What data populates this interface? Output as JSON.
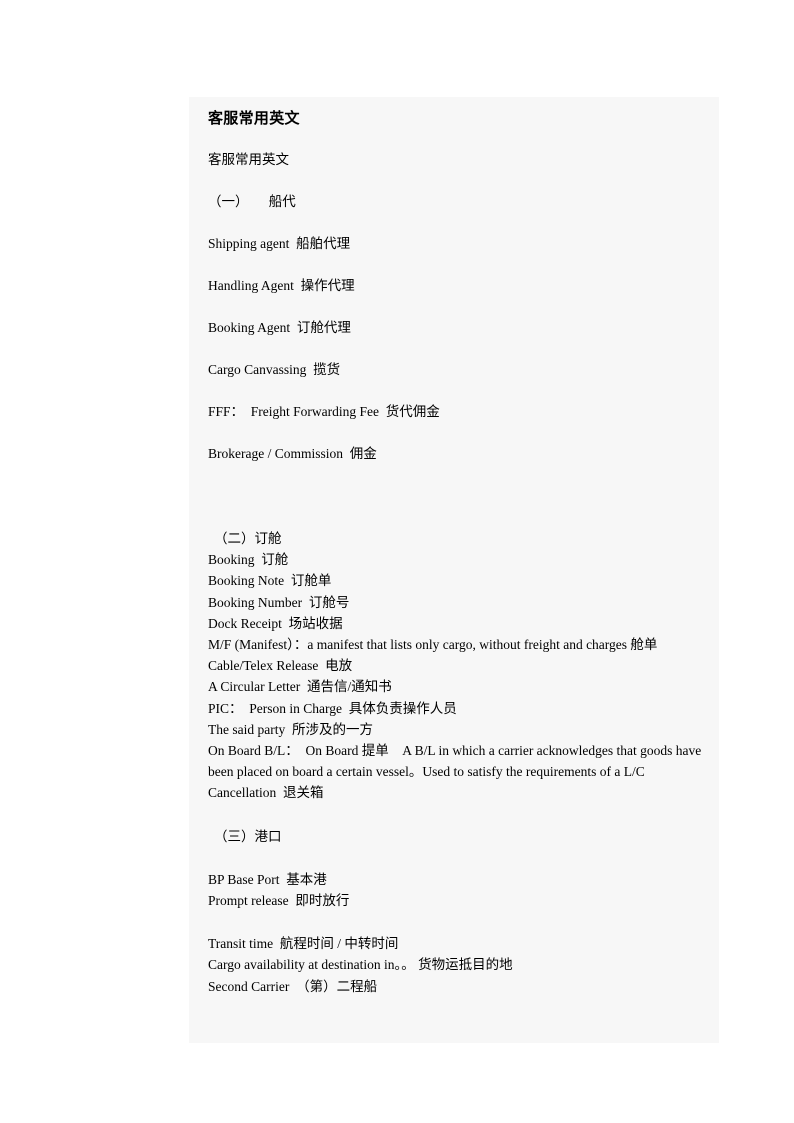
{
  "document": {
    "title": "客服常用英文",
    "panel_background": "#f7f7f7",
    "page_background": "#ffffff",
    "text_color": "#000000"
  },
  "body": {
    "subtitle": "客服常用英文",
    "section_one": {
      "heading": "（一）　　船代",
      "lines": [
        "Shipping agent  船舶代理",
        "Handling Agent  操作代理",
        "Booking Agent  订舱代理",
        "Cargo Canvassing  揽货",
        "FFF：　Freight Forwarding Fee  货代佣金",
        "Brokerage / Commission  佣金"
      ]
    },
    "section_two": {
      "heading": "（二）订舱",
      "lines": [
        "Booking  订舱",
        "Booking Note  订舱单",
        "Booking Number  订舱号",
        "Dock Receipt  场站收据",
        "M/F (Manifest）：a manifest that lists only cargo, without freight and charges 舱单",
        "Cable/Telex Release  电放",
        "A Circular Letter  通告信/通知书",
        "PIC：　Person in Charge  具体负责操作人员",
        "The said party  所涉及的一方",
        "On Board B/L：　On Board 提单　A B/L in which a carrier acknowledges that goods have been placed on board a certain vessel。Used to satisfy the requirements of a L/C",
        "Cancellation  退关箱"
      ]
    },
    "section_three": {
      "heading": "（三）港口",
      "group_one": [
        "BP Base Port  基本港",
        "Prompt release  即时放行"
      ],
      "group_two": [
        "Transit time  航程时间 / 中转时间",
        "Cargo availability at destination in。。 货物运抵目的地",
        "Second Carrier  （第）二程船"
      ]
    }
  }
}
